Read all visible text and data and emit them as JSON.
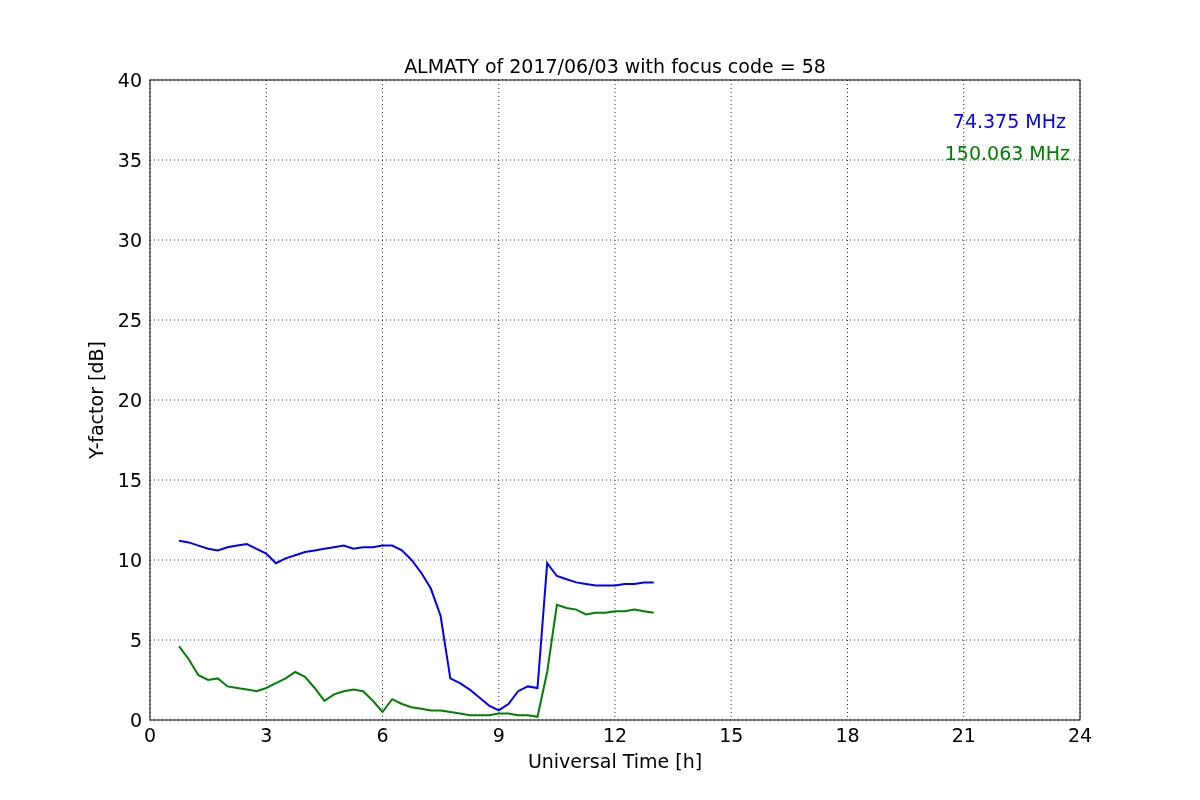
{
  "chart_data": {
    "type": "line",
    "title": "ALMATY of 2017/06/03 with focus code = 58",
    "xlabel": "Universal Time [h]",
    "ylabel": "Y-factor [dB]",
    "x": [
      0.75,
      1,
      1.25,
      1.5,
      1.75,
      2,
      2.25,
      2.5,
      2.75,
      3,
      3.25,
      3.5,
      3.75,
      4,
      4.25,
      4.5,
      4.75,
      5,
      5.25,
      5.5,
      5.75,
      6,
      6.25,
      6.5,
      6.75,
      7,
      7.25,
      7.5,
      7.75,
      8,
      8.25,
      8.5,
      8.75,
      9,
      9.25,
      9.5,
      9.75,
      10,
      10.25,
      10.5,
      10.75,
      11,
      11.25,
      11.5,
      11.75,
      12,
      12.25,
      12.5,
      12.75,
      13
    ],
    "series": [
      {
        "name": "74.375 MHz",
        "color": "#0000ff",
        "values": [
          11.2,
          11.1,
          10.9,
          10.7,
          10.6,
          10.8,
          10.9,
          11.0,
          10.7,
          10.4,
          9.8,
          10.1,
          10.3,
          10.5,
          10.6,
          10.7,
          10.8,
          10.9,
          10.7,
          10.8,
          10.8,
          10.9,
          10.9,
          10.6,
          10.0,
          9.2,
          8.2,
          6.5,
          2.6,
          2.3,
          1.9,
          1.4,
          0.9,
          0.6,
          1.0,
          1.8,
          2.1,
          2.0,
          9.8,
          9.0,
          8.8,
          8.6,
          8.5,
          8.4,
          8.4,
          8.4,
          8.5,
          8.5,
          8.6,
          8.6
        ]
      },
      {
        "name": "150.063 MHz",
        "color": "#008000",
        "values": [
          4.6,
          3.8,
          2.8,
          2.5,
          2.6,
          2.1,
          2.0,
          1.9,
          1.8,
          2.0,
          2.3,
          2.6,
          3.0,
          2.7,
          2.0,
          1.2,
          1.6,
          1.8,
          1.9,
          1.8,
          1.2,
          0.5,
          1.3,
          1.0,
          0.8,
          0.7,
          0.6,
          0.6,
          0.5,
          0.4,
          0.3,
          0.3,
          0.3,
          0.4,
          0.4,
          0.3,
          0.3,
          0.2,
          3.0,
          7.2,
          7.0,
          6.9,
          6.6,
          6.7,
          6.7,
          6.8,
          6.8,
          6.9,
          6.8,
          6.7
        ]
      }
    ],
    "grid": true,
    "xlim": [
      0,
      24
    ],
    "ylim": [
      0,
      40
    ],
    "xticks": [
      0,
      3,
      6,
      9,
      12,
      15,
      18,
      21,
      24
    ],
    "yticks": [
      0,
      5,
      10,
      15,
      20,
      25,
      30,
      35,
      40
    ]
  }
}
